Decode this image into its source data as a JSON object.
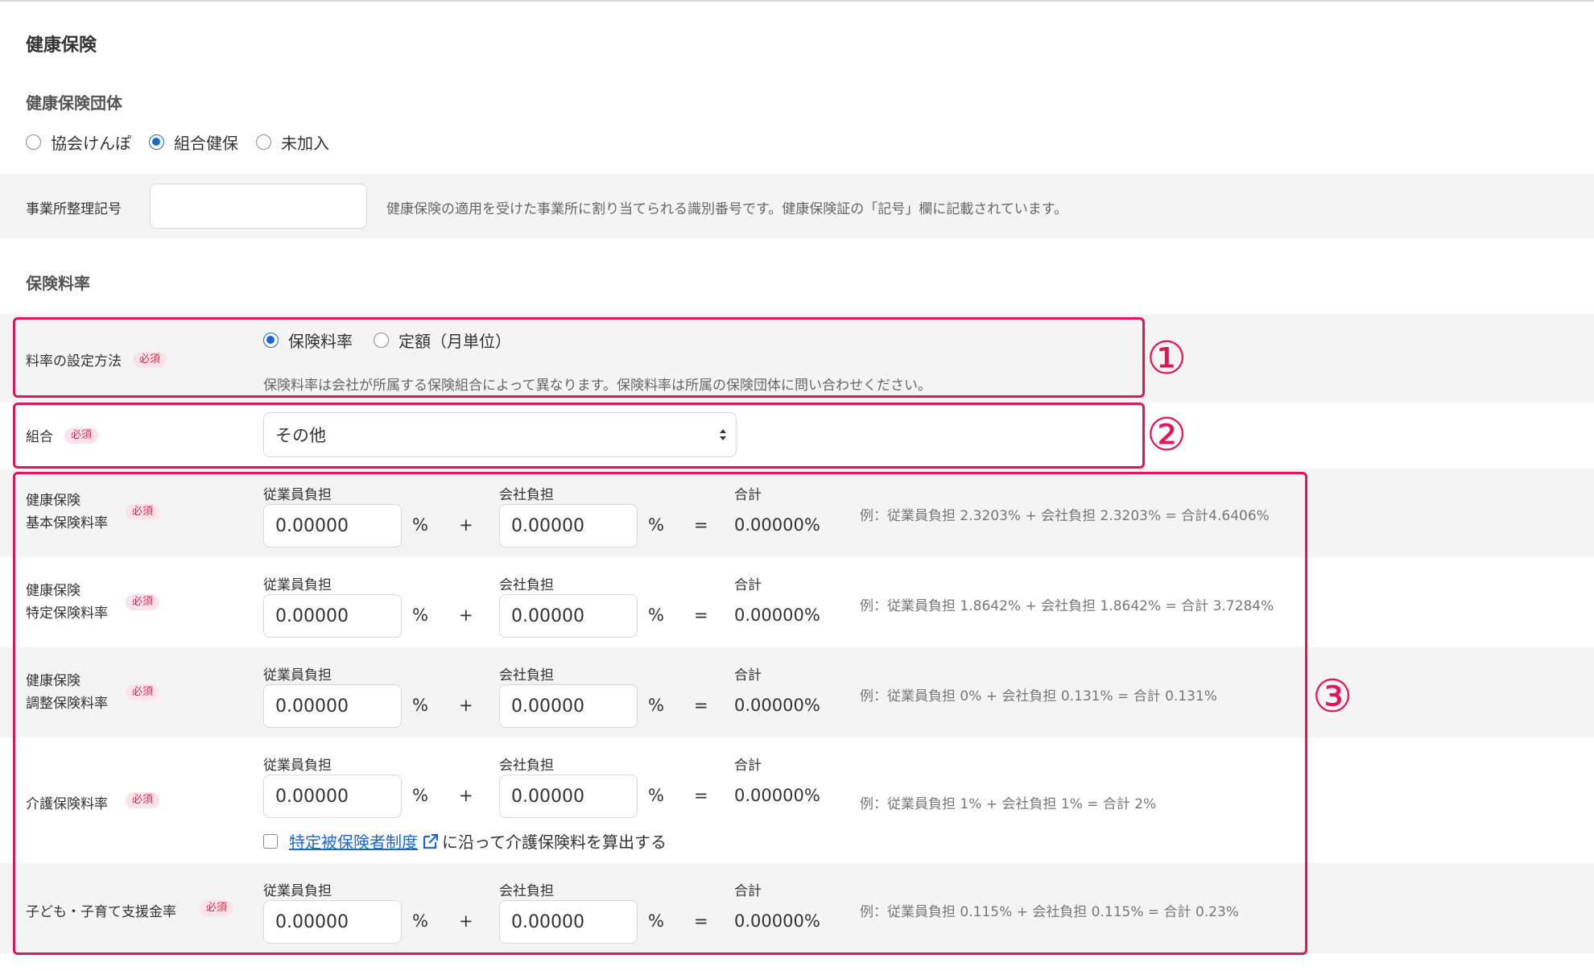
{
  "page": {
    "title": "健康保険",
    "org_section_title": "健康保険団体",
    "org_options": [
      {
        "label": "協会けんぽ",
        "selected": false
      },
      {
        "label": "組合健保",
        "selected": true
      },
      {
        "label": "未加入",
        "selected": false
      }
    ],
    "office_code": {
      "label": "事業所整理記号",
      "value": "",
      "help": "健康保険の適用を受けた事業所に割り当てられる識別番号です。健康保険証の「記号」欄に記載されています。"
    },
    "rate_section_title": "保険料率"
  },
  "required_badge": "必須",
  "rate_method": {
    "label": "料率の設定方法",
    "options": [
      {
        "label": "保険料率",
        "selected": true
      },
      {
        "label": "定額（月単位）",
        "selected": false
      }
    ],
    "help": "保険料率は会社が所属する保険組合によって異なります。保険料率は所属の保険団体に問い合わせください。"
  },
  "union": {
    "label": "組合",
    "selected_value": "その他"
  },
  "rate_columns": {
    "employee": "従業員負担",
    "company": "会社負担",
    "total": "合計",
    "percent": "%",
    "plus": "+",
    "equals": "="
  },
  "rates": [
    {
      "label_line1": "健康保険",
      "label_line2": "基本保険料率",
      "employee": "0.00000",
      "company": "0.00000",
      "total": "0.00000%",
      "example": "例：従業員負担 2.3203% + 会社負担 2.3203% = 合計4.6406%"
    },
    {
      "label_line1": "健康保険",
      "label_line2": "特定保険料率",
      "employee": "0.00000",
      "company": "0.00000",
      "total": "0.00000%",
      "example": "例：従業員負担 1.8642% + 会社負担 1.8642% = 合計 3.7284%"
    },
    {
      "label_line1": "健康保険",
      "label_line2": "調整保険料率",
      "employee": "0.00000",
      "company": "0.00000",
      "total": "0.00000%",
      "example": "例：従業員負担 0% + 会社負担 0.131% = 合計 0.131%"
    },
    {
      "label_line1": "介護保険料率",
      "label_line2": "",
      "employee": "0.00000",
      "company": "0.00000",
      "total": "0.00000%",
      "example": "例：従業員負担 1% + 会社負担 1% = 合計 2%"
    },
    {
      "label_line1": "子ども・子育て支援金率",
      "label_line2": "",
      "employee": "0.00000",
      "company": "0.00000",
      "total": "0.00000%",
      "example": "例：従業員負担 0.115% + 会社負担 0.115% = 合計 0.23%"
    }
  ],
  "care_checkbox": {
    "checked": false,
    "link_text": "特定被保険者制度",
    "suffix": "に沿って介護保険料を算出する"
  },
  "annotations": [
    "①",
    "②",
    "③"
  ],
  "colors": {
    "annotation": "#e4145a",
    "accent": "#1a66d6",
    "badge_text": "#d32a4e",
    "badge_bg": "#fbe4e9",
    "band_bg": "#f5f4f4"
  }
}
